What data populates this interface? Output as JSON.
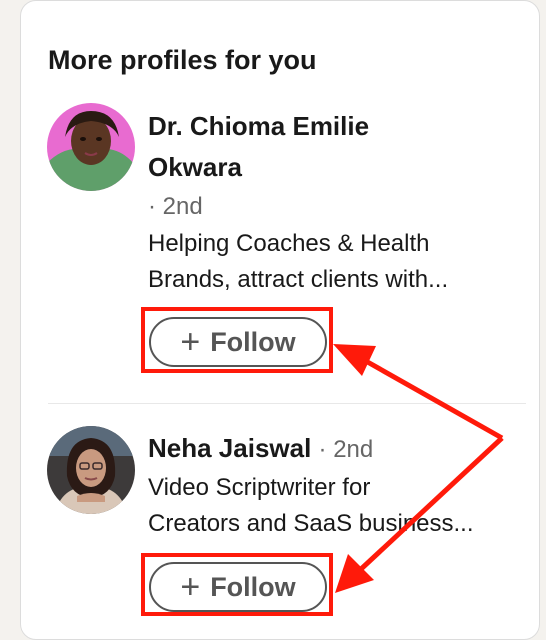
{
  "panel": {
    "title": "More profiles for you"
  },
  "profiles": [
    {
      "name_line1": "Dr. Chioma Emilie",
      "name_line2": "Okwara",
      "degree": "· 2nd",
      "headline_line1": "Helping Coaches & Health",
      "headline_line2": "Brands, attract clients with...",
      "follow_label": "Follow"
    },
    {
      "name": "Neha Jaiswal",
      "degree": "· 2nd",
      "headline_line1": "Video Scriptwriter for",
      "headline_line2": "Creators and SaaS business...",
      "follow_label": "Follow"
    }
  ],
  "colors": {
    "annotation": "#ff1a0a",
    "button_border": "#555555",
    "avatar1_bg": "#e86bd0",
    "avatar2_bg": "#3d3a3a"
  },
  "icons": {
    "follow_icon": "plus-icon"
  }
}
